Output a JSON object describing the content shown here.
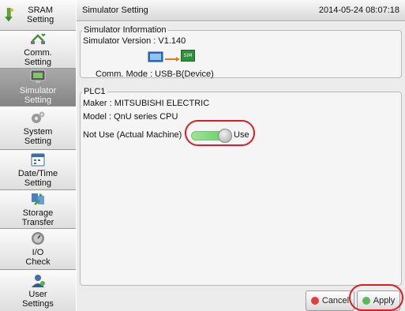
{
  "sidebar": {
    "items": [
      {
        "label": "SRAM\nSetting",
        "icon": "sram-icon"
      },
      {
        "label": "Comm.\nSetting",
        "icon": "network-icon"
      },
      {
        "label": "Simulator\nSetting",
        "icon": "simulator-icon"
      },
      {
        "label": "System\nSetting",
        "icon": "gear-icon"
      },
      {
        "label": "Date/Time\nSetting",
        "icon": "calendar-icon"
      },
      {
        "label": "Storage\nTransfer",
        "icon": "transfer-icon"
      },
      {
        "label": "I/O\nCheck",
        "icon": "io-check-icon"
      },
      {
        "label": "User\nSettings",
        "icon": "user-icon"
      }
    ]
  },
  "header": {
    "title": "Simulator Setting",
    "datetime": "2014-05-24 08:07:18"
  },
  "simulator_info": {
    "legend": "Simulator Information",
    "version": "Simulator Version :  V1.140",
    "comm_mode": "Comm. Mode :  USB-B(Device)",
    "sim_badge": "SIM"
  },
  "plc": {
    "legend": "PLC1",
    "maker": "Maker :  MITSUBISHI ELECTRIC",
    "model": "Model :  QnU series CPU",
    "toggle_off_label": "Not Use (Actual Machine)",
    "toggle_on_label": "Use",
    "toggle_state": "Use"
  },
  "buttons": {
    "cancel": "Cancel",
    "apply": "Apply"
  },
  "colors": {
    "active_sidebar": "#979797",
    "highlight_ring": "#d81f26",
    "toggle_green": "#5fcf5a",
    "cancel_icon": "#e0403b",
    "apply_icon": "#5cb85c"
  }
}
